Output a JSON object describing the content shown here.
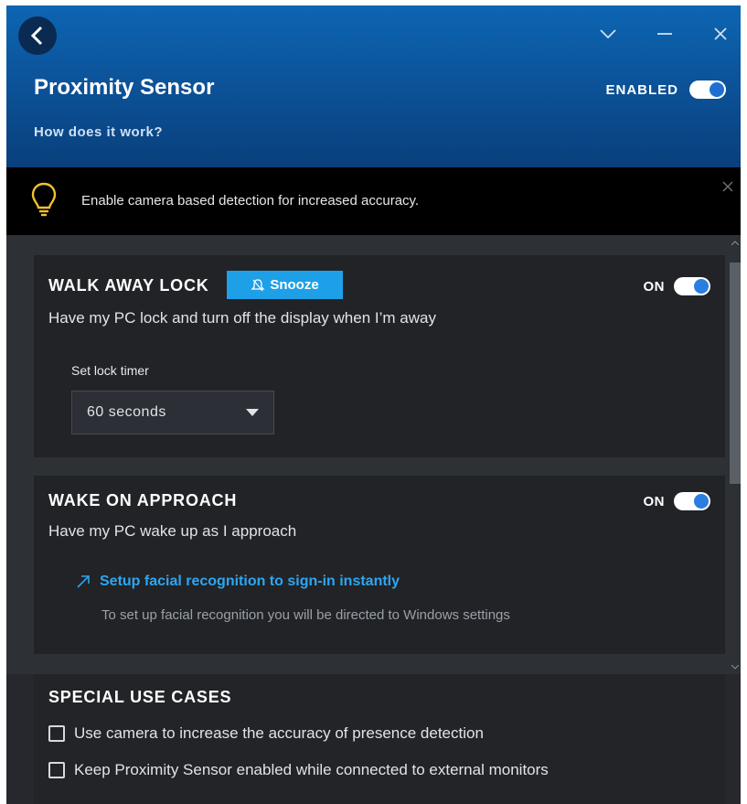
{
  "header": {
    "title": "Proximity Sensor",
    "help_link": "How does it work?",
    "enabled_label": "ENABLED"
  },
  "banner": {
    "text": "Enable camera based detection for increased accuracy.",
    "icon": "lightbulb-icon"
  },
  "walk_away": {
    "title": "WALK AWAY LOCK",
    "snooze_label": "Snooze",
    "state_label": "ON",
    "description": "Have my PC lock and turn off the display when I’m away",
    "timer_label": "Set lock timer",
    "timer_value": "60 seconds"
  },
  "wake": {
    "title": "WAKE ON APPROACH",
    "state_label": "ON",
    "description": "Have my PC wake up as I approach",
    "link_label": "Setup facial recognition to sign-in instantly",
    "link_note": "To set up facial recognition you will be directed to Windows settings"
  },
  "special": {
    "title": "SPECIAL USE CASES",
    "options": [
      {
        "label": "Use camera to increase the accuracy of presence detection",
        "checked": false
      },
      {
        "label": "Keep Proximity Sensor enabled while connected to external monitors",
        "checked": false
      }
    ]
  },
  "colors": {
    "accent": "#1ea0e8",
    "link": "#2ea6f1",
    "header_top": "#0d65b3",
    "header_bottom": "#0a3f7c"
  }
}
